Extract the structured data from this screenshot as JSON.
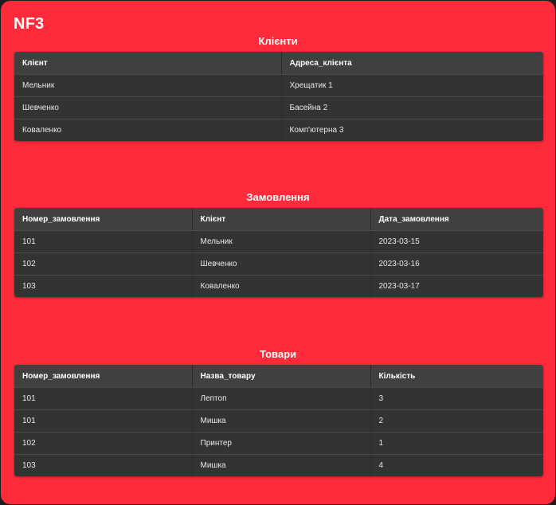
{
  "app": {
    "title": "NF3"
  },
  "clients": {
    "title": "Клієнти",
    "columns": [
      "Клієнт",
      "Адреса_клієнта"
    ],
    "rows": [
      [
        "Мельник",
        "Хрещатик 1"
      ],
      [
        "Шевченко",
        "Басейна 2"
      ],
      [
        "Коваленко",
        "Комп'ютерна 3"
      ]
    ]
  },
  "orders": {
    "title": "Замовлення",
    "columns": [
      "Номер_замовлення",
      "Клієнт",
      "Дата_замовлення"
    ],
    "rows": [
      [
        "101",
        "Мельник",
        "2023-03-15"
      ],
      [
        "102",
        "Шевченко",
        "2023-03-16"
      ],
      [
        "103",
        "Коваленко",
        "2023-03-17"
      ]
    ]
  },
  "products": {
    "title": "Товари",
    "columns": [
      "Номер_замовлення",
      "Назва_товару",
      "Кількість"
    ],
    "rows": [
      [
        "101",
        "Лептоп",
        "3"
      ],
      [
        "101",
        "Мишка",
        "2"
      ],
      [
        "102",
        "Принтер",
        "1"
      ],
      [
        "103",
        "Мишка",
        "4"
      ]
    ]
  },
  "colors": {
    "background": "#ff2a3a",
    "header_row": "#404040",
    "body_row": "#333333",
    "text": "#ffffff"
  }
}
